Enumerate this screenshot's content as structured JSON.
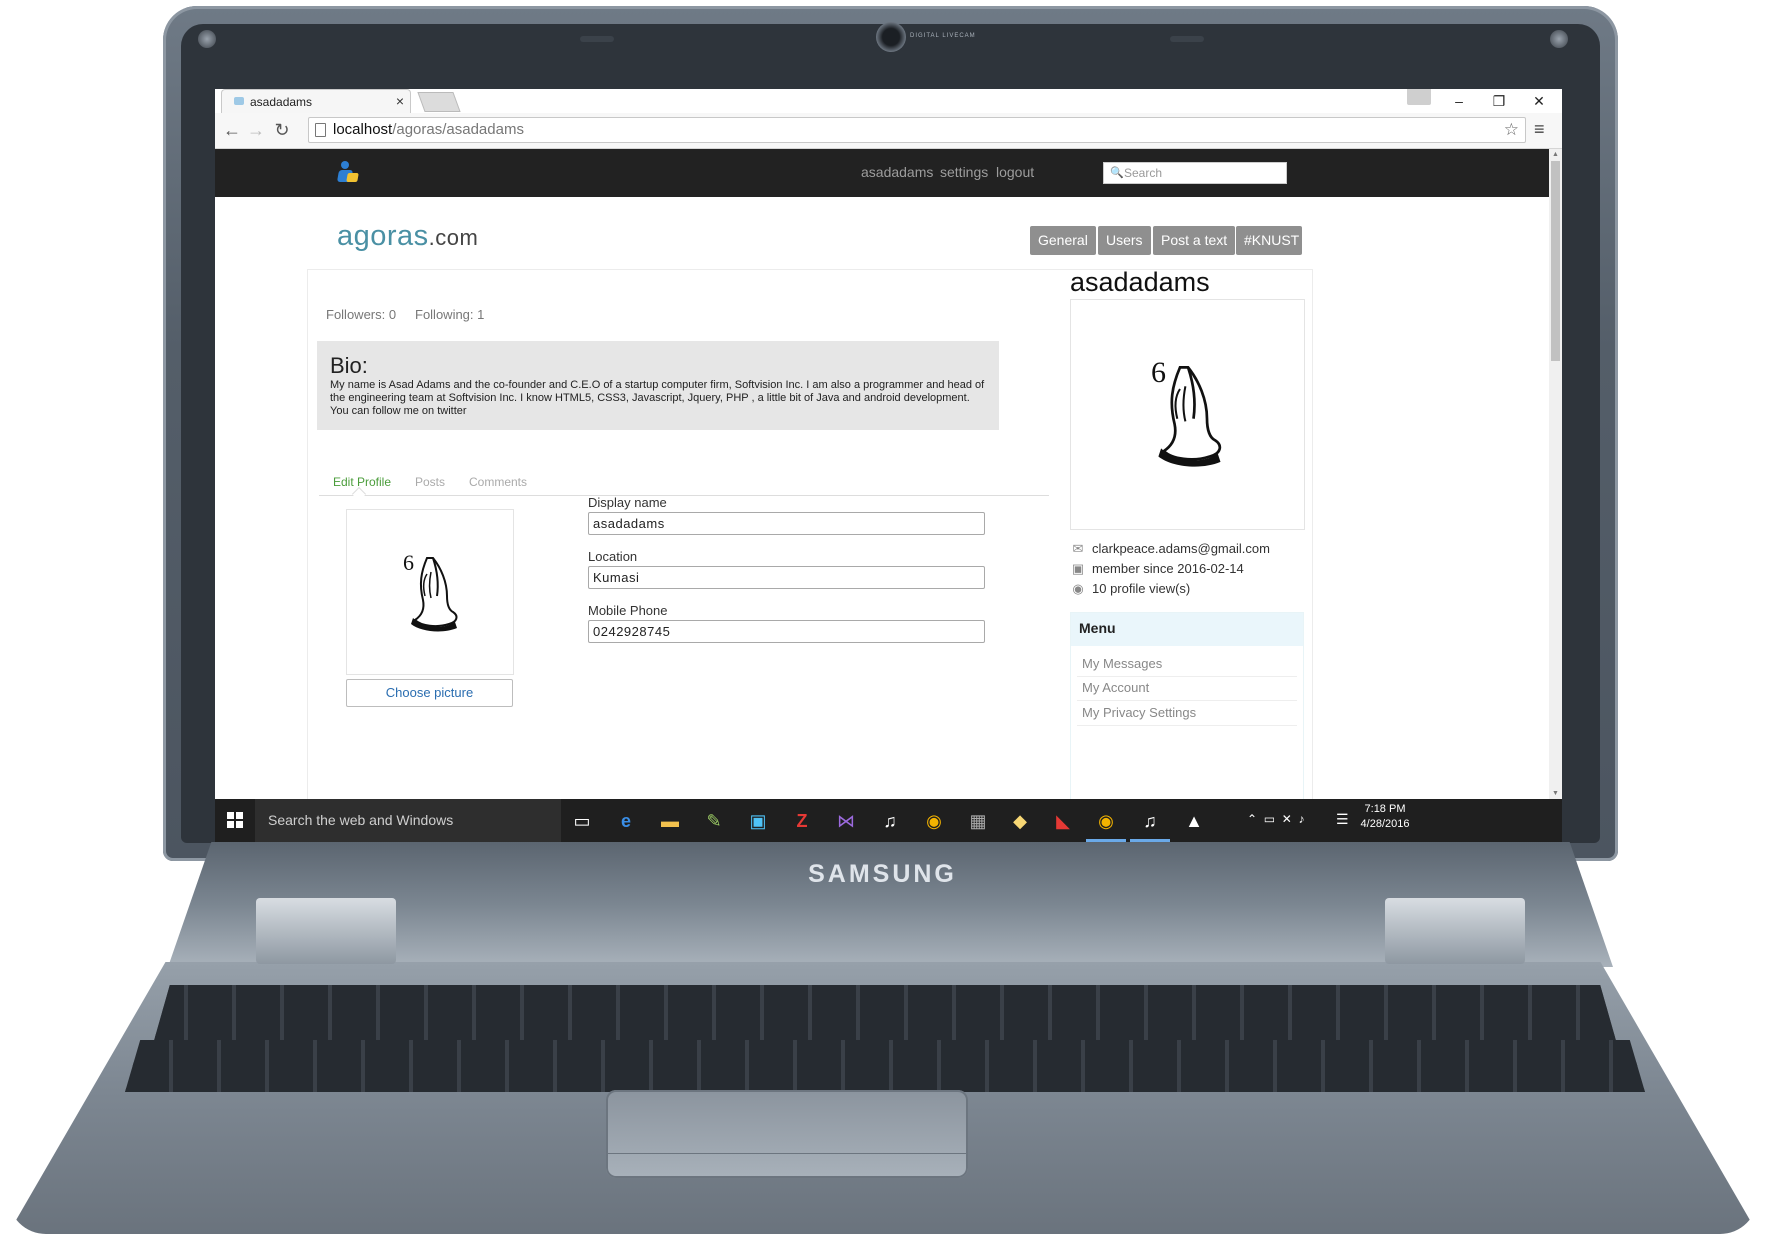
{
  "device": {
    "brand": "SAMSUNG",
    "camera_label": "DIGITAL LIVECAM"
  },
  "browser": {
    "tab_title": "asadadams",
    "url_host": "localhost",
    "url_path": "/agoras/asadadams",
    "window_controls": {
      "minimize": "–",
      "restore": "❐",
      "close": "✕"
    }
  },
  "site_nav": {
    "links": [
      "asadadams",
      "settings",
      "logout"
    ],
    "search_placeholder": "Search"
  },
  "header": {
    "title_main": "agoras",
    "title_tld": ".com",
    "categories": [
      "General",
      "Users",
      "Post a text",
      "#KNUST"
    ]
  },
  "profile": {
    "followers": "Followers: 0",
    "following": "Following: 1",
    "bio_heading": "Bio:",
    "bio_text": "My name is Asad Adams and the co-founder and C.E.O of a startup computer firm, Softvision Inc. I am also a programmer and head of the engineering team at Softvision Inc. I know HTML5, CSS3, Javascript, Jquery, PHP , a little bit of Java and android development. You can follow me on twitter",
    "tabs": [
      "Edit Profile",
      "Posts",
      "Comments"
    ],
    "active_tab": "Edit Profile",
    "choose_picture": "Choose picture",
    "avatar_number": "6",
    "form": {
      "display_name_label": "Display name",
      "display_name_value": "asadadams",
      "location_label": "Location",
      "location_value": "Kumasi",
      "phone_label": "Mobile Phone",
      "phone_value": "0242928745"
    }
  },
  "sidebar": {
    "username": "asadadams",
    "avatar_number": "6",
    "email": "clarkpeace.adams@gmail.com",
    "member_since": "member since 2016-02-14",
    "profile_views": "10 profile view(s)",
    "menu_title": "Menu",
    "menu_items": [
      "My Messages",
      "My Account",
      "My Privacy Settings"
    ]
  },
  "taskbar": {
    "search_text": "Search the web and Windows",
    "time": "7:18 PM",
    "date": "4/28/2016"
  },
  "colors": {
    "site_nav_bg": "#222222",
    "category_button": "#8f8f8f",
    "active_tab": "#4a9c3a",
    "bio_bg": "#e6e6e6",
    "menu_head_bg": "#eaf6fb",
    "taskbar_bg": "#1f1f1f"
  }
}
